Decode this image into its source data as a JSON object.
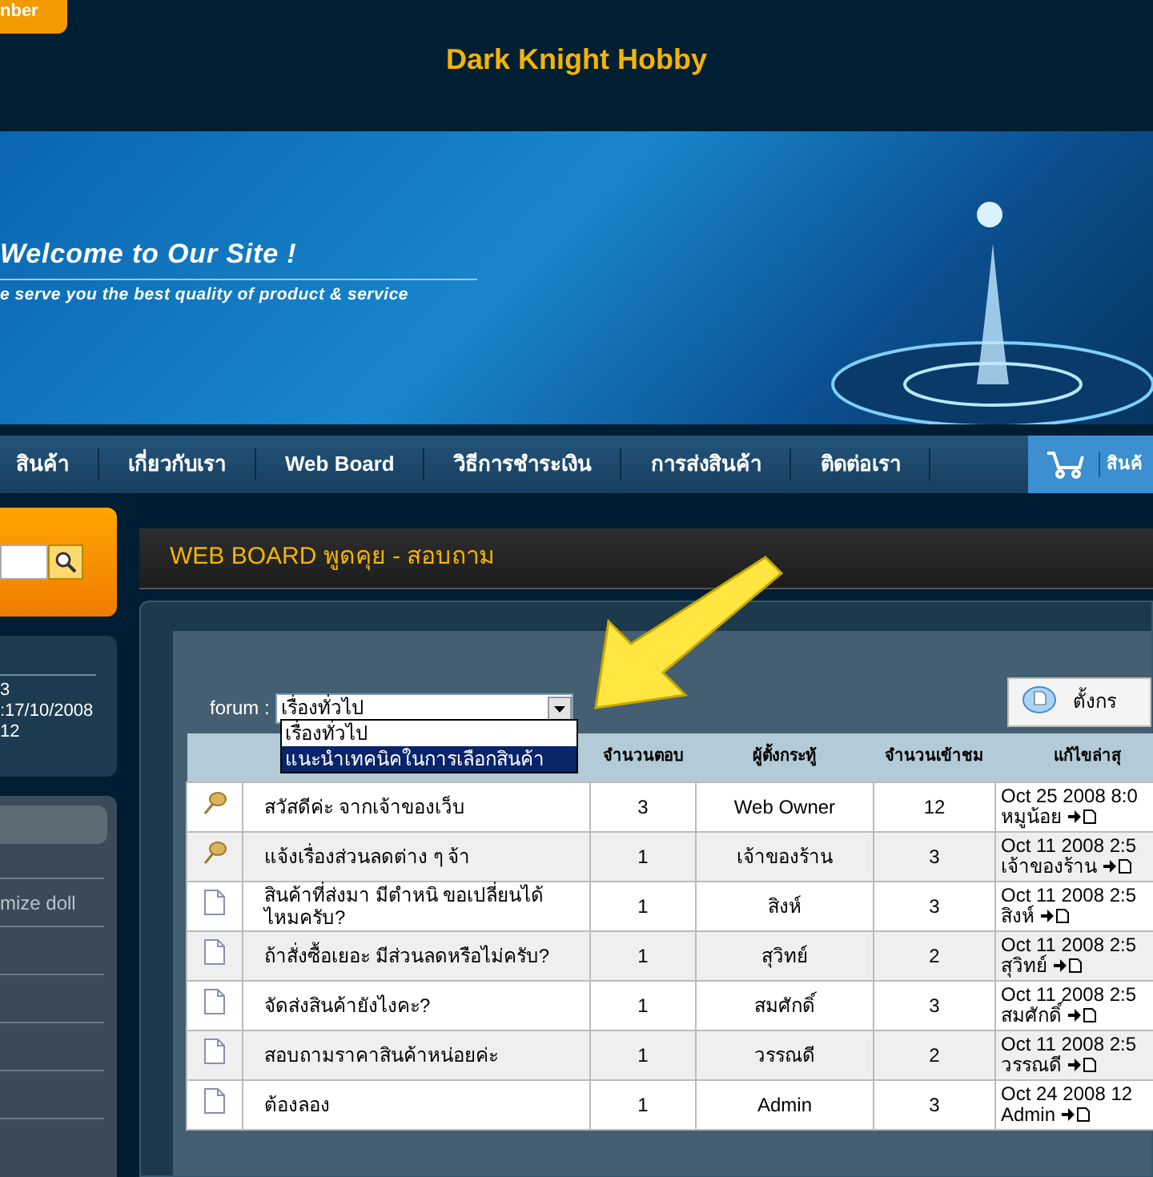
{
  "header": {
    "tab_text": "nber",
    "title": "Dark Knight Hobby"
  },
  "banner": {
    "headline": "Welcome to Our Site !",
    "tagline": "e serve you the best quality of product & service"
  },
  "nav": {
    "items": [
      "สินค้า",
      "เกี่ยวกับเรา",
      "Web Board",
      "วิธีการชำระเงิน",
      "การส่งสินค้า",
      "ติดต่อเรา"
    ],
    "cart_label": "สินค้"
  },
  "sidebar": {
    "info_lines": [
      "3",
      ":17/10/2008",
      "12"
    ],
    "menu_items": [
      "mize doll"
    ]
  },
  "board": {
    "title": "WEB BOARD พูดคุย - สอบถาม",
    "forum_label": "forum :",
    "forum_select": {
      "value": "เรื่องทั่วไป",
      "expanded": true,
      "options": [
        {
          "label": "เรื่องทั่วไป",
          "highlighted": false
        },
        {
          "label": "แนะนำเทคนิคในการเลือกสินค้า",
          "highlighted": true
        }
      ]
    },
    "new_topic_button": "ตั้งกร",
    "table": {
      "columns": [
        "จำนวนตอบ",
        "ผู้ตั้งกระทู้",
        "จำนวนเข้าชม",
        "แก้ไขล่าสุ"
      ],
      "rows": [
        {
          "kind": "pinned",
          "title": "สวัสดีค่ะ จากเจ้าของเว็บ",
          "replies": "3",
          "author": "Web Owner",
          "views": "12",
          "last_date": "Oct 25 2008 8:0",
          "last_by": "หมูน้อย"
        },
        {
          "kind": "pinned",
          "title": "แจ้งเรื่องส่วนลดต่าง ๆ จ้า",
          "replies": "1",
          "author": "เจ้าของร้าน",
          "views": "3",
          "last_date": "Oct 11 2008 2:5",
          "last_by": "เจ้าของร้าน"
        },
        {
          "kind": "normal",
          "title": "สินค้าที่ส่งมา มีตำหนิ ขอเปลี่ยนได้ไหมครับ?",
          "replies": "1",
          "author": "สิงห์",
          "views": "3",
          "last_date": "Oct 11 2008 2:5",
          "last_by": "สิงห์"
        },
        {
          "kind": "normal",
          "title": "ถ้าสั่งซื้อเยอะ มีส่วนลดหรือไม่ครับ?",
          "replies": "1",
          "author": "สุวิทย์",
          "views": "2",
          "last_date": "Oct 11 2008 2:5",
          "last_by": "สุวิทย์"
        },
        {
          "kind": "normal",
          "title": "จัดส่งสินค้ายังไงคะ?",
          "replies": "1",
          "author": "สมศักดิ์",
          "views": "3",
          "last_date": "Oct 11 2008 2:5",
          "last_by": "สมศักดิ์"
        },
        {
          "kind": "normal",
          "title": "สอบถามราคาสินค้าหน่อยค่ะ",
          "replies": "1",
          "author": "วรรณดี",
          "views": "2",
          "last_date": "Oct 11 2008 2:5",
          "last_by": "วรรณดี"
        },
        {
          "kind": "normal",
          "title": "ต้องลอง",
          "replies": "1",
          "author": "Admin",
          "views": "3",
          "last_date": "Oct 24 2008 12",
          "last_by": "Admin"
        }
      ]
    }
  }
}
